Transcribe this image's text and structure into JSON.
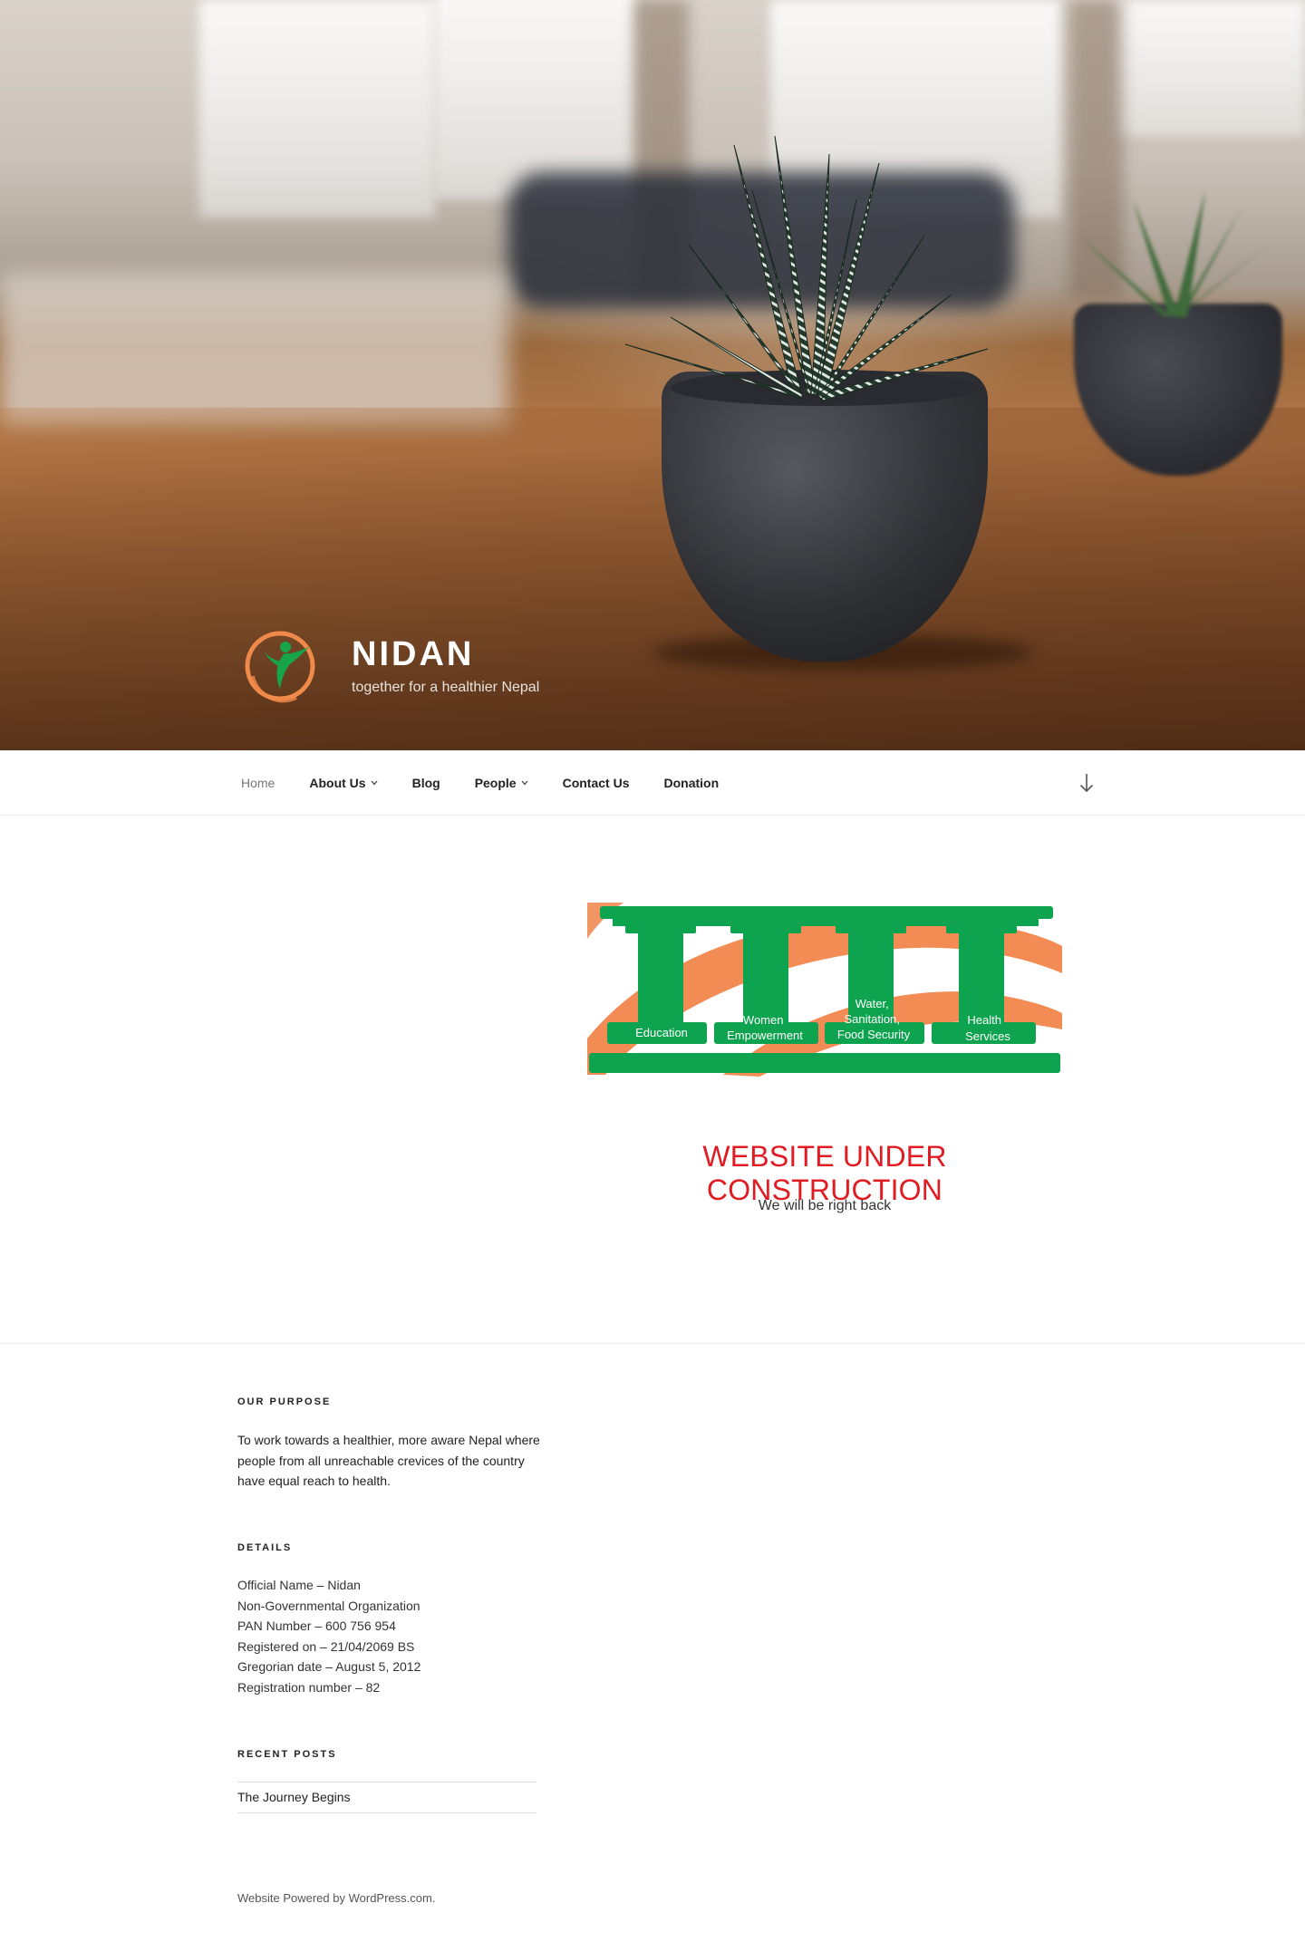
{
  "site": {
    "title": "NIDAN",
    "tagline": "together for a healthier Nepal",
    "logo_icon": "nidan-figure-logo",
    "colors": {
      "logo_orange": "#f08a4b",
      "logo_green": "#17a44a",
      "accent_red": "#e11b22",
      "banner_green": "#0ea34f",
      "banner_orange": "#f28b54"
    }
  },
  "nav": {
    "items": [
      {
        "label": "Home",
        "current": true,
        "has_submenu": false
      },
      {
        "label": "About Us",
        "current": false,
        "has_submenu": true
      },
      {
        "label": "Blog",
        "current": false,
        "has_submenu": false
      },
      {
        "label": "People",
        "current": false,
        "has_submenu": true
      },
      {
        "label": "Contact Us",
        "current": false,
        "has_submenu": false
      },
      {
        "label": "Donation",
        "current": false,
        "has_submenu": false
      }
    ],
    "scroll_icon": "arrow-down-icon"
  },
  "main": {
    "banner": {
      "pillars": [
        "Education",
        "Women Empowerment",
        "Water, Sanitation, Food Security",
        "Health Services"
      ],
      "pillar_lines": [
        [
          "Education"
        ],
        [
          "Women",
          "Empowerment"
        ],
        [
          "Water,",
          "Sanitation,",
          "Food Security"
        ],
        [
          "Health",
          "Services"
        ]
      ]
    },
    "heading": "WEBSITE UNDER CONSTRUCTION",
    "subtext": "We will be right back"
  },
  "footer": {
    "purpose": {
      "title": "OUR PURPOSE",
      "text": "To work towards a healthier, more aware Nepal where people from all unreachable crevices of the country have equal reach to health."
    },
    "details": {
      "title": "DETAILS",
      "lines": [
        "Official Name – Nidan",
        "Non-Governmental Organization",
        "PAN Number – 600 756 954",
        "Registered on – 21/04/2069 BS",
        "Gregorian date – August 5, 2012",
        "Registration number – 82"
      ]
    },
    "recent_posts": {
      "title": "RECENT POSTS",
      "items": [
        "The Journey Begins"
      ]
    },
    "powered_by": "Website Powered by WordPress.com."
  }
}
